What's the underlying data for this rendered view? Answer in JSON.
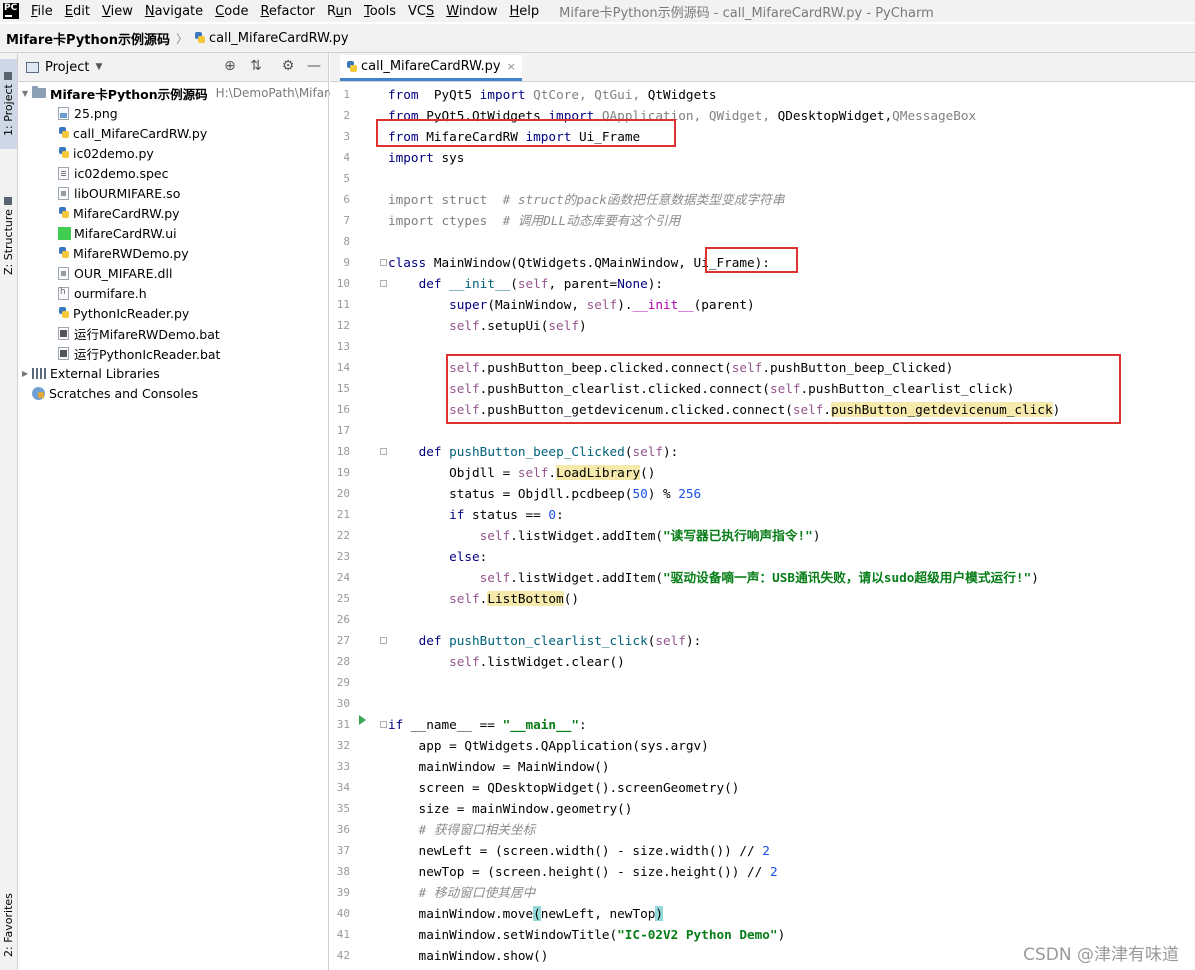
{
  "menubar": {
    "logo": "PC",
    "items": [
      {
        "label": "File",
        "mnemonic": "F",
        "rest": "ile"
      },
      {
        "label": "Edit",
        "mnemonic": "E",
        "rest": "dit"
      },
      {
        "label": "View",
        "mnemonic": "V",
        "rest": "iew"
      },
      {
        "label": "Navigate",
        "mnemonic": "N",
        "rest": "avigate"
      },
      {
        "label": "Code",
        "mnemonic": "C",
        "rest": "ode"
      },
      {
        "label": "Refactor",
        "mnemonic": "R",
        "rest": "efactor"
      },
      {
        "label": "Run",
        "mnemonic": "u",
        "pre": "R",
        "rest": "n"
      },
      {
        "label": "Tools",
        "mnemonic": "T",
        "rest": "ools"
      },
      {
        "label": "VCS",
        "mnemonic": "S",
        "pre": "VC",
        "rest": ""
      },
      {
        "label": "Window",
        "mnemonic": "W",
        "rest": "indow"
      },
      {
        "label": "Help",
        "mnemonic": "H",
        "rest": "elp"
      }
    ],
    "window_title": "Mifare卡Python示例源码 - call_MifareCardRW.py - PyCharm"
  },
  "navbar": {
    "project": "Mifare卡Python示例源码",
    "separator": "〉",
    "file": "call_MifareCardRW.py"
  },
  "tool_stripe": {
    "project_tab": "1: Project",
    "structure_tab": "Z: Structure",
    "favorites_tab": "2: Favorites"
  },
  "project_panel": {
    "title": "Project",
    "dropdown": "▼",
    "root": {
      "label": "Mifare卡Python示例源码",
      "path": "H:\\DemoPath\\Mifare-"
    },
    "files": [
      {
        "name": "25.png",
        "kind": "img"
      },
      {
        "name": "call_MifareCardRW.py",
        "kind": "py"
      },
      {
        "name": "ic02demo.py",
        "kind": "py"
      },
      {
        "name": "ic02demo.spec",
        "kind": "spec"
      },
      {
        "name": "libOURMIFARE.so",
        "kind": "so"
      },
      {
        "name": "MifareCardRW.py",
        "kind": "py"
      },
      {
        "name": "MifareCardRW.ui",
        "kind": "qt"
      },
      {
        "name": "MifareRWDemo.py",
        "kind": "py"
      },
      {
        "name": "OUR_MIFARE.dll",
        "kind": "dll"
      },
      {
        "name": "ourmifare.h",
        "kind": "h"
      },
      {
        "name": "PythonIcReader.py",
        "kind": "py"
      },
      {
        "name": "运行MifareRWDemo.bat",
        "kind": "bat"
      },
      {
        "name": "运行PythonIcReader.bat",
        "kind": "bat"
      }
    ],
    "external_libraries": "External Libraries",
    "scratches": "Scratches and Consoles"
  },
  "editor": {
    "tab_label": "call_MifareCardRW.py",
    "tab_close": "×",
    "lines": [
      [
        [
          "kw",
          "from"
        ],
        [
          "",
          "  PyQt5 "
        ],
        [
          "kw",
          "import"
        ],
        [
          "gray",
          " QtCore, QtGui, "
        ],
        [
          "",
          "QtWidgets"
        ]
      ],
      [
        [
          "kw",
          "from"
        ],
        [
          "",
          " PyQt5.QtWidgets "
        ],
        [
          "kw",
          "import"
        ],
        [
          "gray",
          " QApplication, QWidget, "
        ],
        [
          "",
          "QDesktopWidget,"
        ],
        [
          "gray",
          "QMessageBox"
        ]
      ],
      [
        [
          "kw",
          "from"
        ],
        [
          "",
          " MifareCardRW "
        ],
        [
          "kw",
          "import"
        ],
        [
          "",
          " Ui_Frame"
        ]
      ],
      [
        [
          "kw",
          "import"
        ],
        [
          "",
          " sys"
        ]
      ],
      [],
      [
        [
          "gray",
          "import struct  "
        ],
        [
          "cmt",
          "# struct的pack函数把任意数据类型变成字符串"
        ]
      ],
      [
        [
          "gray",
          "import ctypes  "
        ],
        [
          "cmt",
          "# 调用DLL动态库要有这个引用"
        ]
      ],
      [],
      [
        [
          "kw",
          "class"
        ],
        [
          "",
          " MainWindow(QtWidgets.QMainWindow, Ui_Frame):"
        ]
      ],
      [
        [
          "",
          "    "
        ],
        [
          "kw",
          "def"
        ],
        [
          "",
          " "
        ],
        [
          "fnname",
          "__init__"
        ],
        [
          "",
          "("
        ],
        [
          "selfk",
          "self"
        ],
        [
          "",
          ", parent="
        ],
        [
          "kw",
          "None"
        ],
        [
          "",
          "):"
        ]
      ],
      [
        [
          "",
          "        "
        ],
        [
          "bi",
          "super"
        ],
        [
          "",
          "(MainWindow, "
        ],
        [
          "selfk",
          "self"
        ],
        [
          "",
          ")."
        ],
        [
          "dunder",
          "__init__"
        ],
        [
          "",
          "(parent)"
        ]
      ],
      [
        [
          "",
          "        "
        ],
        [
          "selfk",
          "self"
        ],
        [
          "",
          ".setupUi("
        ],
        [
          "selfk",
          "self"
        ],
        [
          "",
          ")"
        ]
      ],
      [],
      [
        [
          "",
          "        "
        ],
        [
          "selfk",
          "self"
        ],
        [
          "",
          ".pushButton_beep.clicked.connect("
        ],
        [
          "selfk",
          "self"
        ],
        [
          "",
          ".pushButton_beep_Clicked)"
        ]
      ],
      [
        [
          "",
          "        "
        ],
        [
          "selfk",
          "self"
        ],
        [
          "",
          ".pushButton_clearlist.clicked.connect("
        ],
        [
          "selfk",
          "self"
        ],
        [
          "",
          ".pushButton_clearlist_click)"
        ]
      ],
      [
        [
          "",
          "        "
        ],
        [
          "selfk",
          "self"
        ],
        [
          "",
          ".pushButton_getdevicenum.clicked.connect("
        ],
        [
          "selfk",
          "self"
        ],
        [
          "",
          "."
        ],
        [
          "hl-yellow",
          "pushButton_getdevicenum_click"
        ],
        [
          "",
          ")"
        ]
      ],
      [],
      [
        [
          "",
          "    "
        ],
        [
          "kw",
          "def"
        ],
        [
          "",
          " "
        ],
        [
          "fnname",
          "pushButton_beep_Clicked"
        ],
        [
          "",
          "("
        ],
        [
          "selfk",
          "self"
        ],
        [
          "",
          "):"
        ]
      ],
      [
        [
          "",
          "        Objdll = "
        ],
        [
          "selfk",
          "self"
        ],
        [
          "",
          "."
        ],
        [
          "hl-yellow",
          "LoadLibrary"
        ],
        [
          "",
          "()"
        ]
      ],
      [
        [
          "",
          "        status = Objdll.pcdbeep("
        ],
        [
          "num",
          "50"
        ],
        [
          "",
          ") % "
        ],
        [
          "num",
          "256"
        ]
      ],
      [
        [
          "",
          "        "
        ],
        [
          "kw",
          "if"
        ],
        [
          "",
          " status == "
        ],
        [
          "num",
          "0"
        ],
        [
          "",
          ":"
        ]
      ],
      [
        [
          "",
          "            "
        ],
        [
          "selfk",
          "self"
        ],
        [
          "",
          ".listWidget.addItem("
        ],
        [
          "str",
          "\"读写器已执行响声指令!\""
        ],
        [
          "",
          ")"
        ]
      ],
      [
        [
          "",
          "        "
        ],
        [
          "kw",
          "else"
        ],
        [
          "",
          ":"
        ]
      ],
      [
        [
          "",
          "            "
        ],
        [
          "selfk",
          "self"
        ],
        [
          "",
          ".listWidget.addItem("
        ],
        [
          "str",
          "\"驱动设备嘀一声：USB通讯失败，请以sudo超级用户模式运行!\""
        ],
        [
          "",
          ")"
        ]
      ],
      [
        [
          "",
          "        "
        ],
        [
          "selfk",
          "self"
        ],
        [
          "",
          "."
        ],
        [
          "hl-yellow",
          "ListBottom"
        ],
        [
          "",
          "()"
        ]
      ],
      [],
      [
        [
          "",
          "    "
        ],
        [
          "kw",
          "def"
        ],
        [
          "",
          " "
        ],
        [
          "fnname",
          "pushButton_clearlist_click"
        ],
        [
          "",
          "("
        ],
        [
          "selfk",
          "self"
        ],
        [
          "",
          "):"
        ]
      ],
      [
        [
          "",
          "        "
        ],
        [
          "selfk",
          "self"
        ],
        [
          "",
          ".listWidget.clear()"
        ]
      ],
      [],
      [],
      [
        [
          "kw",
          "if"
        ],
        [
          "",
          " __name__ == "
        ],
        [
          "str",
          "\"__main__\""
        ],
        [
          "",
          ":"
        ]
      ],
      [
        [
          "",
          "    app = QtWidgets.QApplication(sys.argv)"
        ]
      ],
      [
        [
          "",
          "    mainWindow = MainWindow()"
        ]
      ],
      [
        [
          "",
          "    screen = QDesktopWidget().screenGeometry()"
        ]
      ],
      [
        [
          "",
          "    size = mainWindow.geometry()"
        ]
      ],
      [
        [
          "",
          "    "
        ],
        [
          "cmt",
          "# 获得窗口相关坐标"
        ]
      ],
      [
        [
          "",
          "    newLeft = (screen.width() - size.width()) // "
        ],
        [
          "num",
          "2"
        ]
      ],
      [
        [
          "",
          "    newTop = (screen.height() - size.height()) // "
        ],
        [
          "num",
          "2"
        ]
      ],
      [
        [
          "",
          "    "
        ],
        [
          "cmt",
          "# 移动窗口使其居中"
        ]
      ],
      [
        [
          "",
          "    mainWindow.move"
        ],
        [
          "hl-brace",
          "("
        ],
        [
          "",
          "newLeft, newTop"
        ],
        [
          "hl-brace",
          ")"
        ]
      ],
      [
        [
          "",
          "    mainWindow.setWindowTitle("
        ],
        [
          "str",
          "\"IC-02V2 Python Demo\""
        ],
        [
          "",
          ")"
        ]
      ],
      [
        [
          "",
          "    mainWindow.show()"
        ]
      ]
    ]
  },
  "watermark": "CSDN @津津有味道"
}
